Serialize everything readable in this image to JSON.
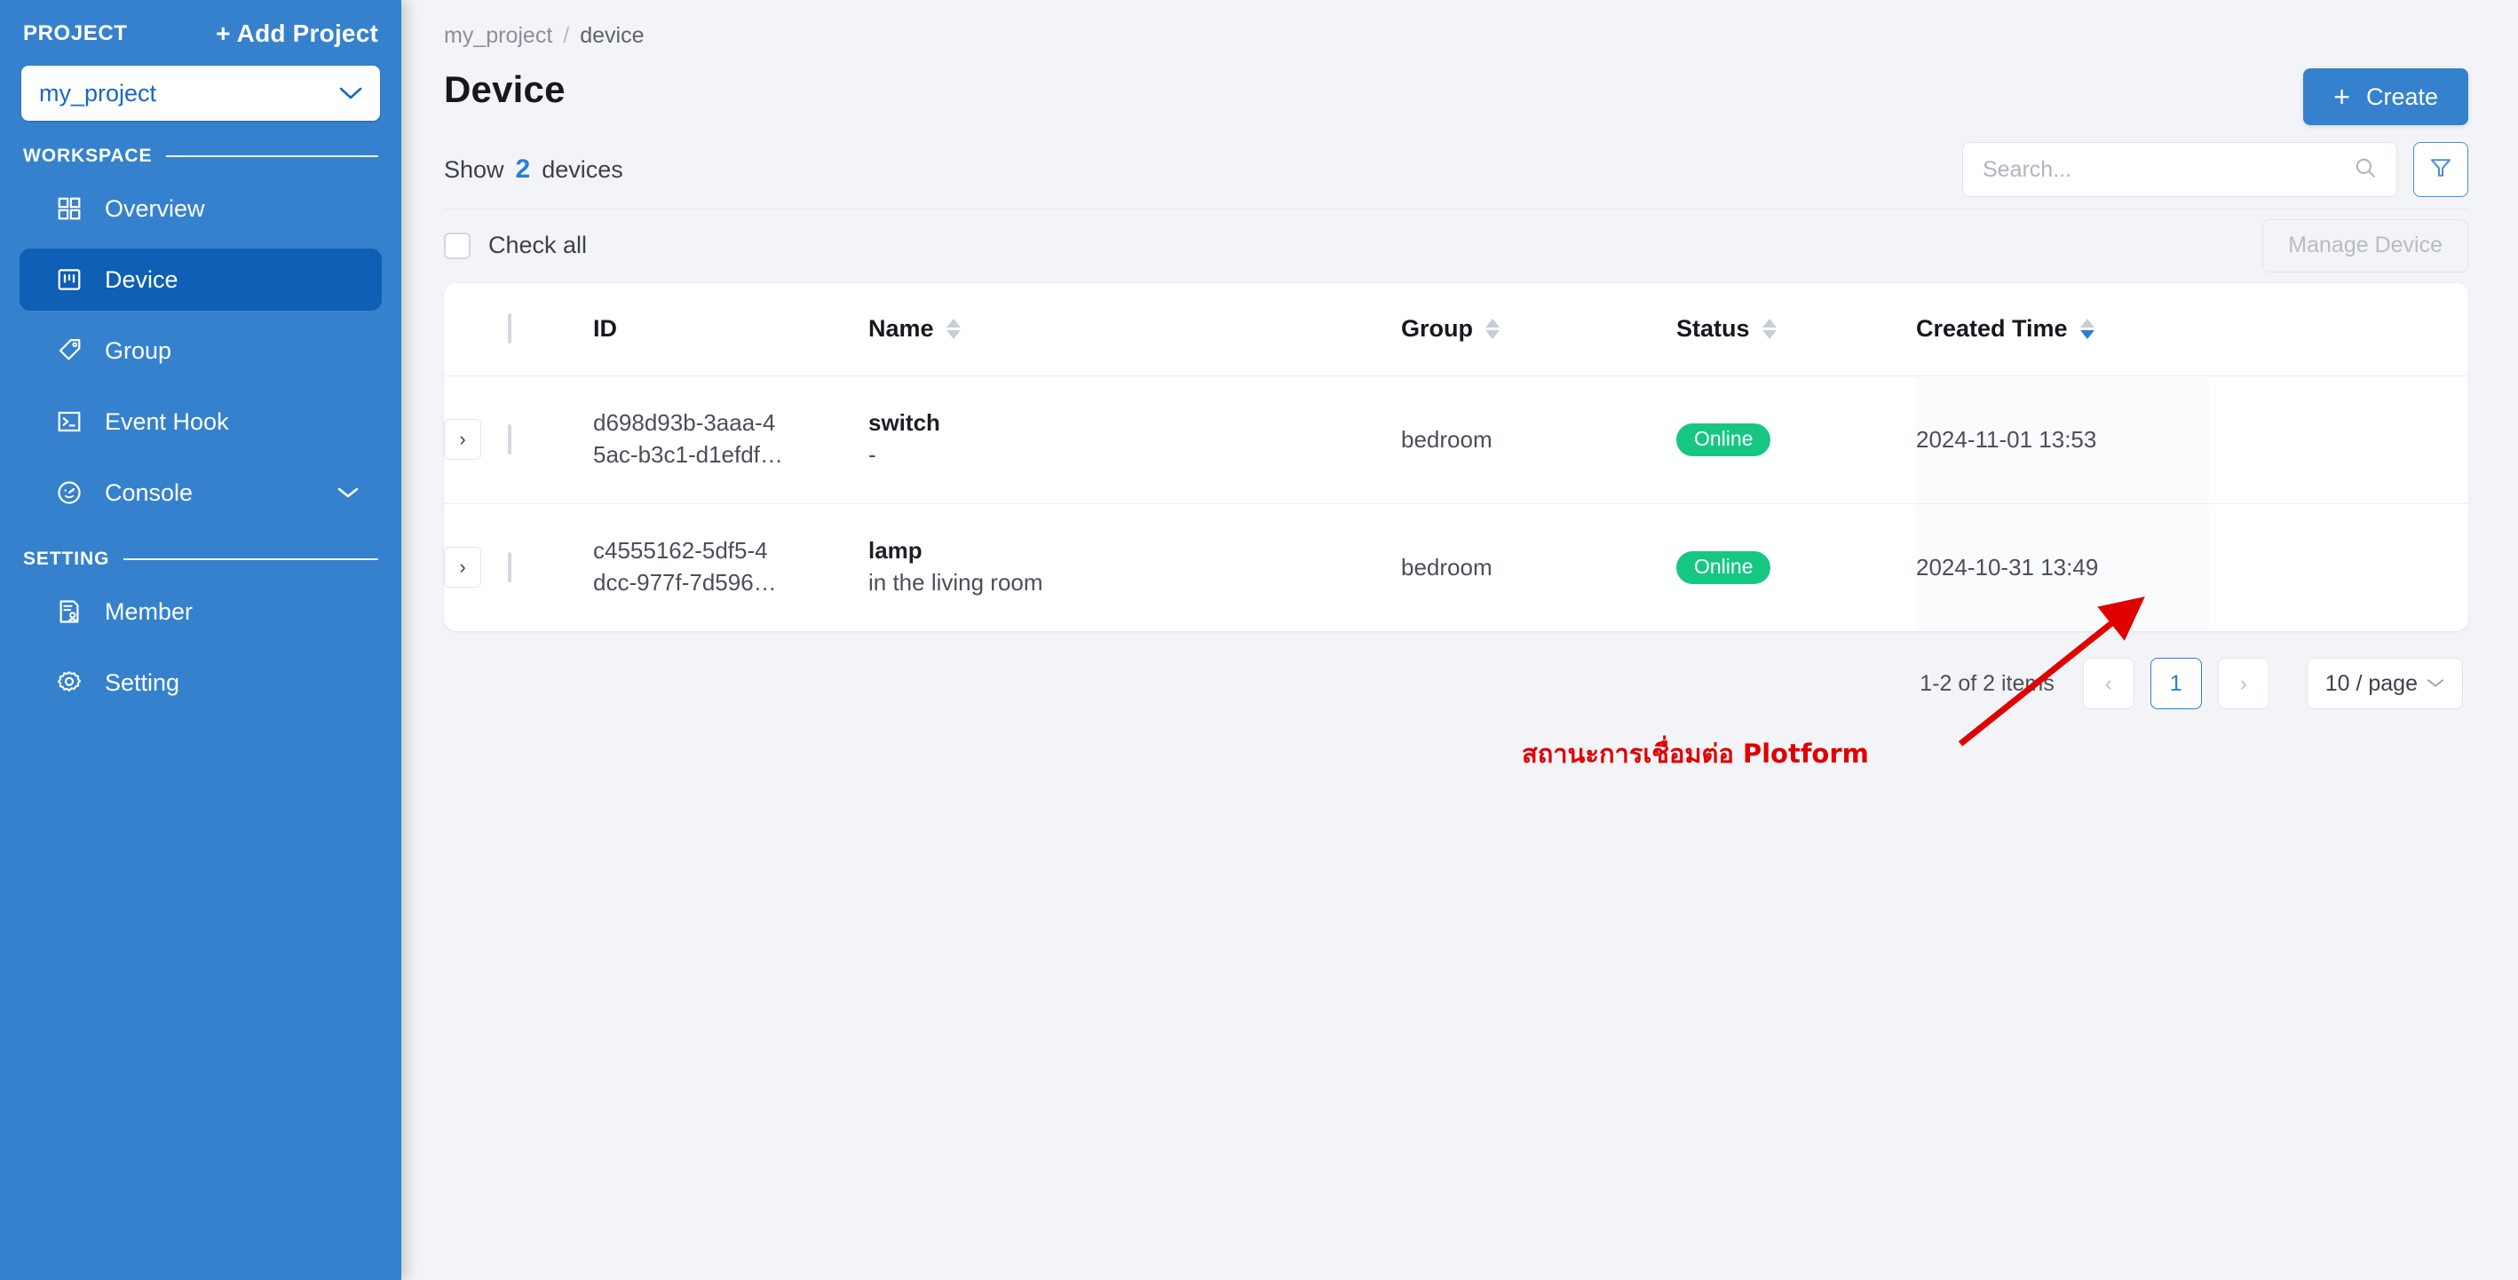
{
  "sidebar": {
    "project_label": "PROJECT",
    "add_project_label": "+ Add Project",
    "project_select_value": "my_project",
    "workspace_label": "WORKSPACE",
    "setting_label": "SETTING",
    "workspace_items": [
      {
        "label": "Overview",
        "icon": "grid-icon",
        "active": false,
        "chevron": ""
      },
      {
        "label": "Device",
        "icon": "device-icon",
        "active": true,
        "chevron": ""
      },
      {
        "label": "Group",
        "icon": "tag-icon",
        "active": false,
        "chevron": ""
      },
      {
        "label": "Event Hook",
        "icon": "terminal-icon",
        "active": false,
        "chevron": ""
      },
      {
        "label": "Console",
        "icon": "gauge-icon",
        "active": false,
        "chevron": "⌄"
      }
    ],
    "setting_items": [
      {
        "label": "Member",
        "icon": "member-icon"
      },
      {
        "label": "Setting",
        "icon": "gear-icon"
      }
    ],
    "colors": {
      "background": "#3581cd",
      "active": "#0e5fb5"
    }
  },
  "breadcrumb": {
    "root": "my_project",
    "separator": "/",
    "current": "device"
  },
  "header": {
    "title": "Device",
    "create_label": "Create",
    "create_plus": "+",
    "create_color": "#3581cd"
  },
  "toolbar": {
    "show_prefix": "Show",
    "show_count": "2",
    "show_suffix": "devices",
    "search_placeholder": "Search...",
    "search_value": "",
    "check_all_label": "Check all",
    "manage_device_label": "Manage Device"
  },
  "table": {
    "columns": [
      {
        "key": "id",
        "label": "ID",
        "sortable": false,
        "sort": "none"
      },
      {
        "key": "name",
        "label": "Name",
        "sortable": true,
        "sort": "none"
      },
      {
        "key": "group",
        "label": "Group",
        "sortable": true,
        "sort": "none"
      },
      {
        "key": "status",
        "label": "Status",
        "sortable": true,
        "sort": "none"
      },
      {
        "key": "created",
        "label": "Created Time",
        "sortable": true,
        "sort": "desc"
      }
    ],
    "rows": [
      {
        "expand": "›",
        "id_line1": "d698d93b-3aaa-4",
        "id_line2": "5ac-b3c1-d1efdf…",
        "name": "switch",
        "description": "-",
        "group": "bedroom",
        "status": "Online",
        "created": "2024-11-01 13:53"
      },
      {
        "expand": "›",
        "id_line1": "c4555162-5df5-4",
        "id_line2": "dcc-977f-7d596…",
        "name": "lamp",
        "description": "in the living room",
        "group": "bedroom",
        "status": "Online",
        "created": "2024-10-31 13:49"
      }
    ],
    "status_color": "#16c784"
  },
  "pagination": {
    "range_label": "1-2 of 2 items",
    "prev": "‹",
    "next": "›",
    "current_page": "1",
    "page_size_label": "10 / page",
    "page_size_chev": "⌄"
  },
  "annotation": {
    "text": "สถานะการเชื่อมต่อ Plotform",
    "color": "#e00000"
  }
}
